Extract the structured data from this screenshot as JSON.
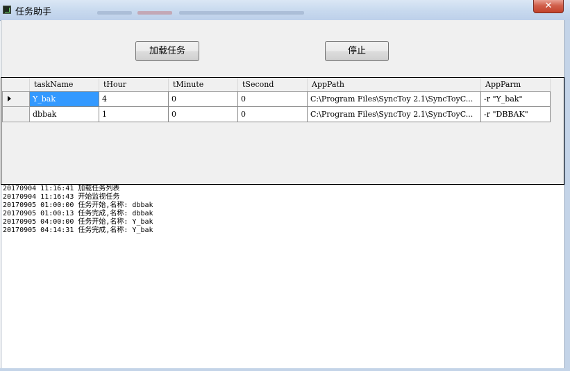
{
  "window": {
    "title": "任务助手",
    "close_symbol": "✕"
  },
  "toolbar": {
    "load_label": "加载任务",
    "stop_label": "停止"
  },
  "grid": {
    "columns": [
      "taskName",
      "tHour",
      "tMinute",
      "tSecond",
      "AppPath",
      "AppParm"
    ],
    "rows": [
      {
        "taskName": "Y_bak",
        "tHour": "4",
        "tMinute": "0",
        "tSecond": "0",
        "AppPath": "C:\\Program Files\\SyncToy 2.1\\SyncToyC...",
        "AppParm": "-r \"Y_bak\"",
        "selected": true
      },
      {
        "taskName": "dbbak",
        "tHour": "1",
        "tMinute": "0",
        "tSecond": "0",
        "AppPath": "C:\\Program Files\\SyncToy 2.1\\SyncToyC...",
        "AppParm": "-r \"DBBAK\"",
        "selected": false
      }
    ]
  },
  "log": {
    "lines": [
      "20170904 11:16:41 加载任务列表",
      "20170904 11:16:43 开始监视任务",
      "20170905 01:00:00 任务开始,名称: dbbak",
      "20170905 01:00:13 任务完成,名称: dbbak",
      "20170905 04:00:00 任务开始,名称: Y_bak",
      "20170905 04:14:31 任务完成,名称: Y_bak"
    ]
  },
  "colors": {
    "selection": "#3399ff",
    "close_button": "#c3422b",
    "titlebar": "#c7d9ee"
  },
  "icons": {
    "app": "app-icon",
    "row_indicator": "row-pointer-icon"
  }
}
